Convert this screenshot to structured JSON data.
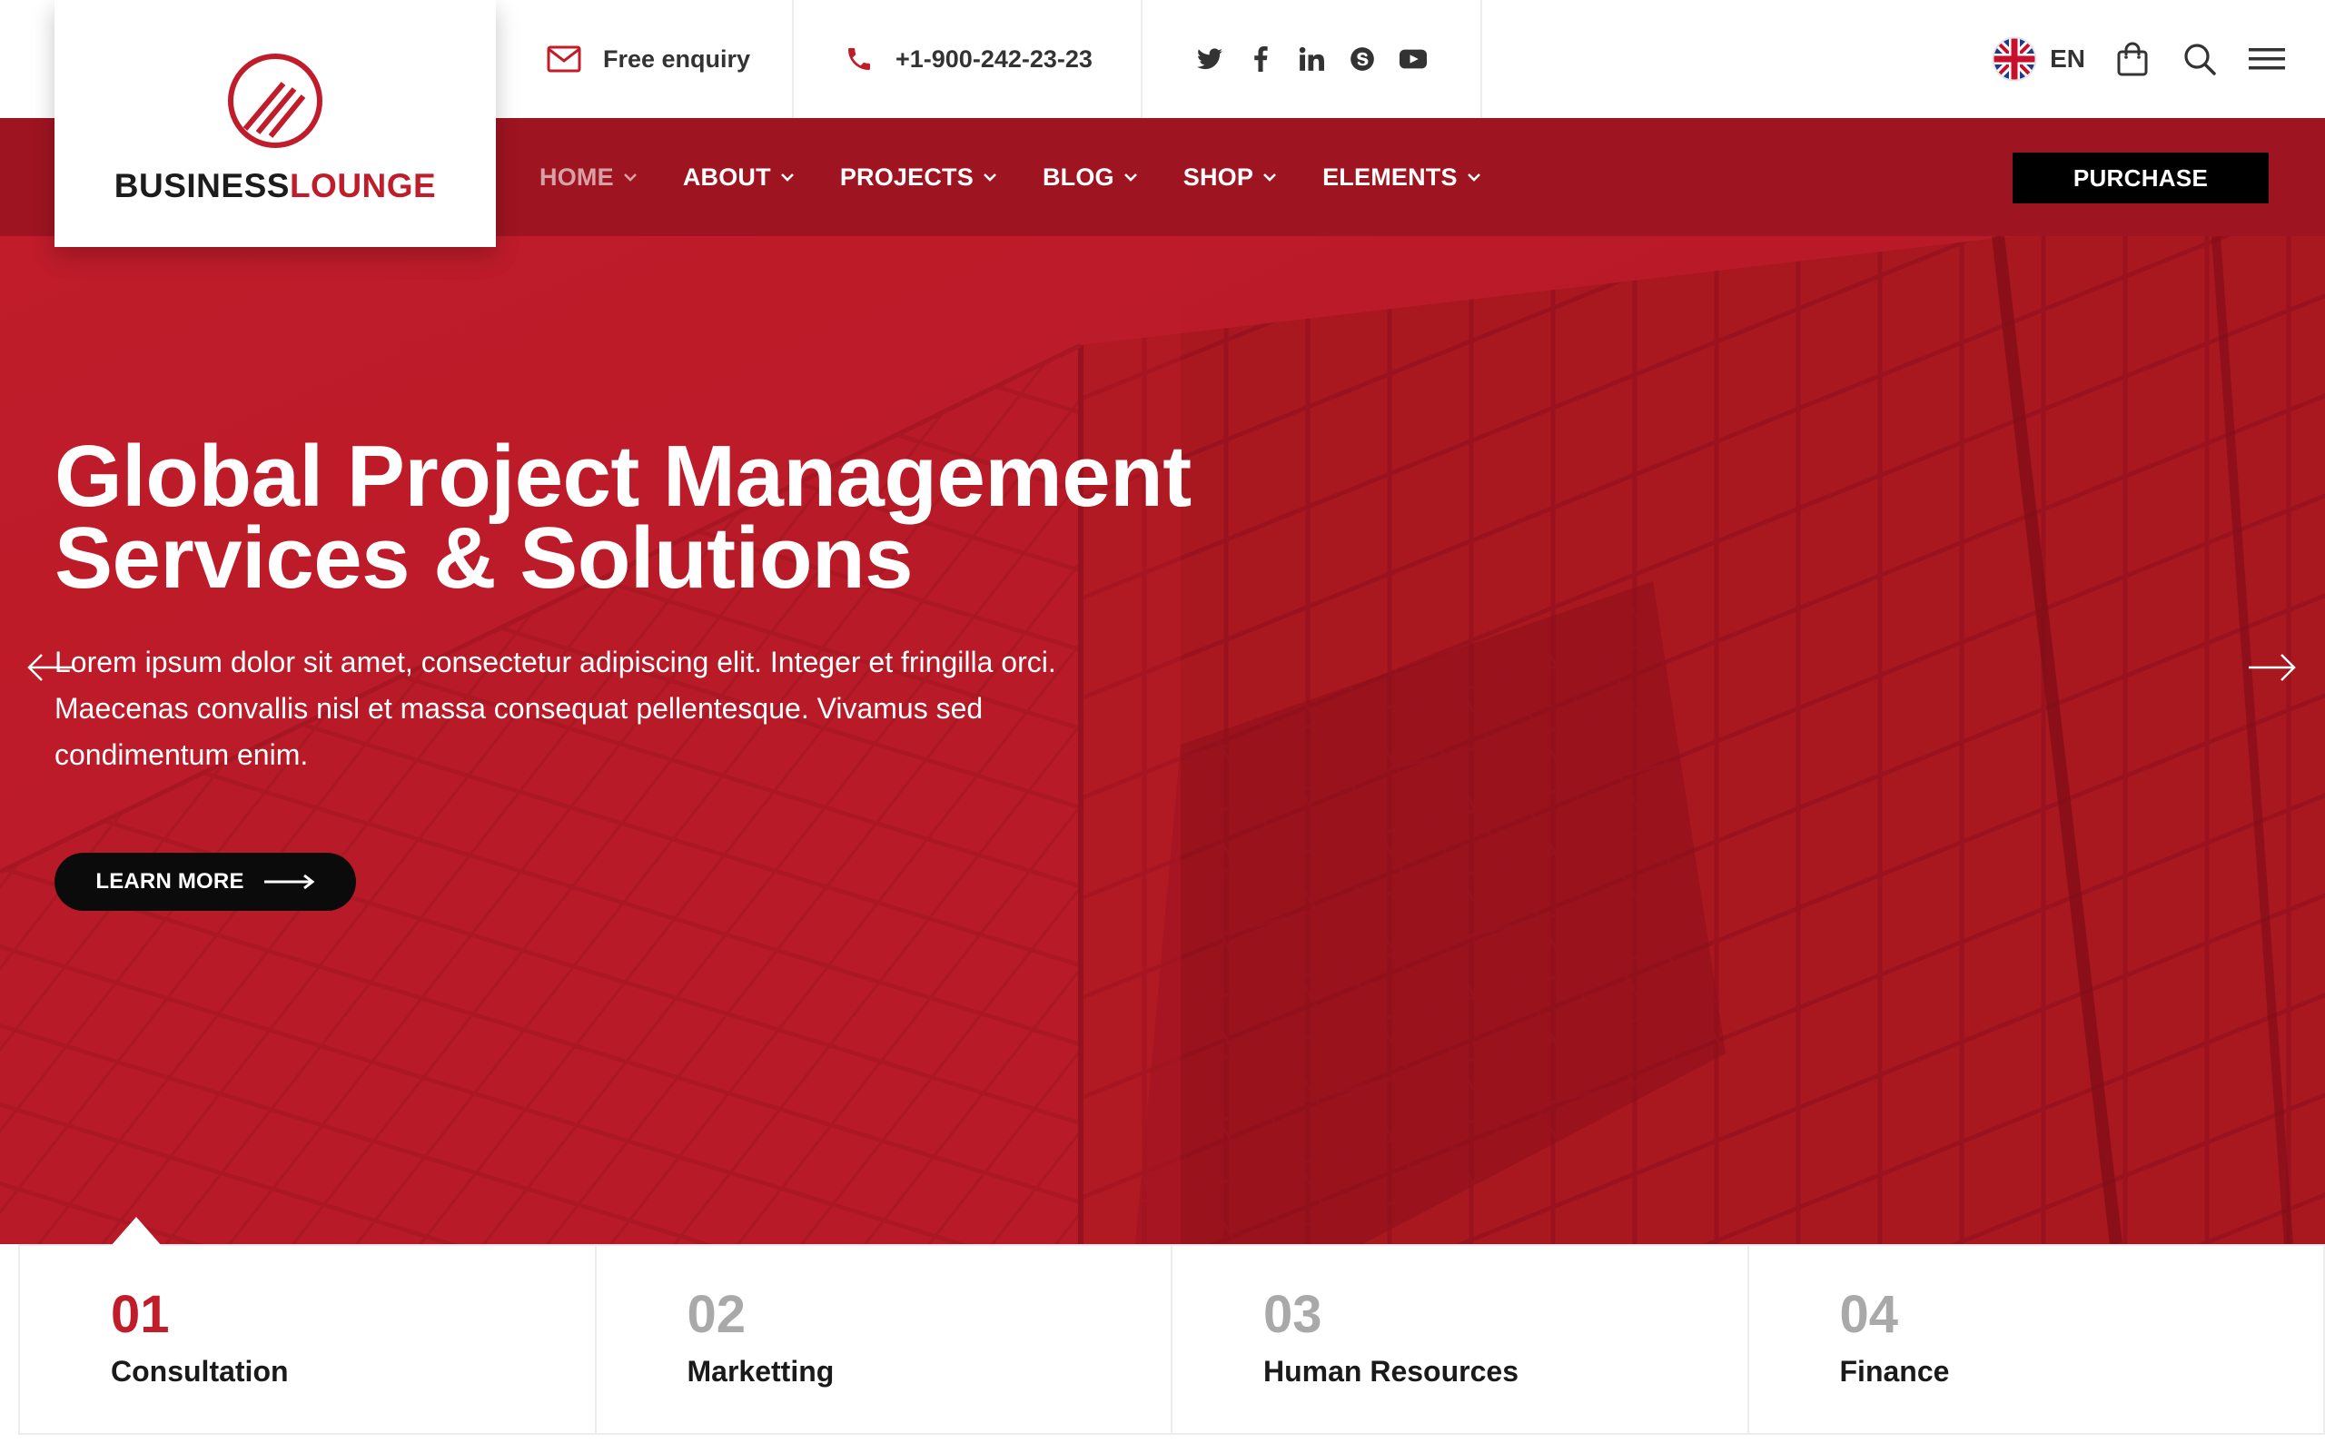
{
  "colors": {
    "brand": "#c01c2a",
    "brand_dark": "#9e1420",
    "ink": "#1a1a1a",
    "muted": "#a9a9a9"
  },
  "logo": {
    "word_1": "BUSINESS",
    "word_2": "LOUNGE"
  },
  "topbar": {
    "enquiry": {
      "icon": "envelope-icon",
      "label": "Free enquiry"
    },
    "phone": {
      "icon": "phone-icon",
      "label": "+1-900-242-23-23"
    },
    "social": [
      "twitter-icon",
      "facebook-icon",
      "linkedin-icon",
      "skype-icon",
      "youtube-icon"
    ],
    "language": {
      "flag": "uk-flag-icon",
      "code": "EN"
    },
    "icons": [
      "shopping-bag-icon",
      "search-icon",
      "menu-icon"
    ]
  },
  "nav": {
    "items": [
      {
        "label": "HOME",
        "active": true
      },
      {
        "label": "ABOUT"
      },
      {
        "label": "PROJECTS"
      },
      {
        "label": "BLOG"
      },
      {
        "label": "SHOP"
      },
      {
        "label": "ELEMENTS"
      }
    ],
    "purchase_label": "PURCHASE"
  },
  "hero": {
    "title_line_1": "Global Project Management",
    "title_line_2": "Services & Solutions",
    "text": "Lorem ipsum dolor sit amet, consectetur adipiscing elit. Integer et fringilla orci. Maecenas convallis nisl et massa consequat pellentesque. Vivamus sed condimentum enim.",
    "cta_label": "LEARN MORE"
  },
  "services": [
    {
      "num": "01",
      "name": "Consultation",
      "active": true
    },
    {
      "num": "02",
      "name": "Marketting"
    },
    {
      "num": "03",
      "name": "Human Resources"
    },
    {
      "num": "04",
      "name": "Finance"
    }
  ]
}
